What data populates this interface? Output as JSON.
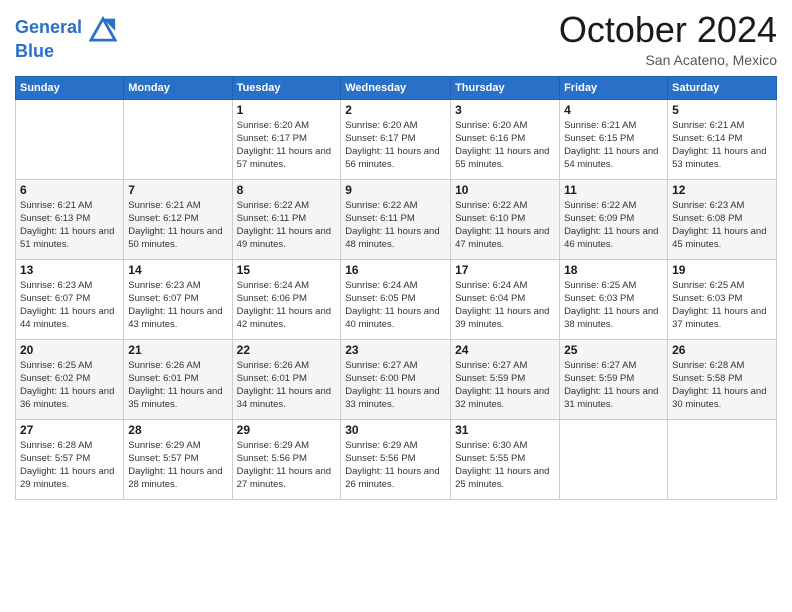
{
  "header": {
    "logo_line1": "General",
    "logo_line2": "Blue",
    "month": "October 2024",
    "location": "San Acateno, Mexico"
  },
  "weekdays": [
    "Sunday",
    "Monday",
    "Tuesday",
    "Wednesday",
    "Thursday",
    "Friday",
    "Saturday"
  ],
  "weeks": [
    [
      {
        "day": "",
        "info": ""
      },
      {
        "day": "",
        "info": ""
      },
      {
        "day": "1",
        "info": "Sunrise: 6:20 AM\nSunset: 6:17 PM\nDaylight: 11 hours and 57 minutes."
      },
      {
        "day": "2",
        "info": "Sunrise: 6:20 AM\nSunset: 6:17 PM\nDaylight: 11 hours and 56 minutes."
      },
      {
        "day": "3",
        "info": "Sunrise: 6:20 AM\nSunset: 6:16 PM\nDaylight: 11 hours and 55 minutes."
      },
      {
        "day": "4",
        "info": "Sunrise: 6:21 AM\nSunset: 6:15 PM\nDaylight: 11 hours and 54 minutes."
      },
      {
        "day": "5",
        "info": "Sunrise: 6:21 AM\nSunset: 6:14 PM\nDaylight: 11 hours and 53 minutes."
      }
    ],
    [
      {
        "day": "6",
        "info": "Sunrise: 6:21 AM\nSunset: 6:13 PM\nDaylight: 11 hours and 51 minutes."
      },
      {
        "day": "7",
        "info": "Sunrise: 6:21 AM\nSunset: 6:12 PM\nDaylight: 11 hours and 50 minutes."
      },
      {
        "day": "8",
        "info": "Sunrise: 6:22 AM\nSunset: 6:11 PM\nDaylight: 11 hours and 49 minutes."
      },
      {
        "day": "9",
        "info": "Sunrise: 6:22 AM\nSunset: 6:11 PM\nDaylight: 11 hours and 48 minutes."
      },
      {
        "day": "10",
        "info": "Sunrise: 6:22 AM\nSunset: 6:10 PM\nDaylight: 11 hours and 47 minutes."
      },
      {
        "day": "11",
        "info": "Sunrise: 6:22 AM\nSunset: 6:09 PM\nDaylight: 11 hours and 46 minutes."
      },
      {
        "day": "12",
        "info": "Sunrise: 6:23 AM\nSunset: 6:08 PM\nDaylight: 11 hours and 45 minutes."
      }
    ],
    [
      {
        "day": "13",
        "info": "Sunrise: 6:23 AM\nSunset: 6:07 PM\nDaylight: 11 hours and 44 minutes."
      },
      {
        "day": "14",
        "info": "Sunrise: 6:23 AM\nSunset: 6:07 PM\nDaylight: 11 hours and 43 minutes."
      },
      {
        "day": "15",
        "info": "Sunrise: 6:24 AM\nSunset: 6:06 PM\nDaylight: 11 hours and 42 minutes."
      },
      {
        "day": "16",
        "info": "Sunrise: 6:24 AM\nSunset: 6:05 PM\nDaylight: 11 hours and 40 minutes."
      },
      {
        "day": "17",
        "info": "Sunrise: 6:24 AM\nSunset: 6:04 PM\nDaylight: 11 hours and 39 minutes."
      },
      {
        "day": "18",
        "info": "Sunrise: 6:25 AM\nSunset: 6:03 PM\nDaylight: 11 hours and 38 minutes."
      },
      {
        "day": "19",
        "info": "Sunrise: 6:25 AM\nSunset: 6:03 PM\nDaylight: 11 hours and 37 minutes."
      }
    ],
    [
      {
        "day": "20",
        "info": "Sunrise: 6:25 AM\nSunset: 6:02 PM\nDaylight: 11 hours and 36 minutes."
      },
      {
        "day": "21",
        "info": "Sunrise: 6:26 AM\nSunset: 6:01 PM\nDaylight: 11 hours and 35 minutes."
      },
      {
        "day": "22",
        "info": "Sunrise: 6:26 AM\nSunset: 6:01 PM\nDaylight: 11 hours and 34 minutes."
      },
      {
        "day": "23",
        "info": "Sunrise: 6:27 AM\nSunset: 6:00 PM\nDaylight: 11 hours and 33 minutes."
      },
      {
        "day": "24",
        "info": "Sunrise: 6:27 AM\nSunset: 5:59 PM\nDaylight: 11 hours and 32 minutes."
      },
      {
        "day": "25",
        "info": "Sunrise: 6:27 AM\nSunset: 5:59 PM\nDaylight: 11 hours and 31 minutes."
      },
      {
        "day": "26",
        "info": "Sunrise: 6:28 AM\nSunset: 5:58 PM\nDaylight: 11 hours and 30 minutes."
      }
    ],
    [
      {
        "day": "27",
        "info": "Sunrise: 6:28 AM\nSunset: 5:57 PM\nDaylight: 11 hours and 29 minutes."
      },
      {
        "day": "28",
        "info": "Sunrise: 6:29 AM\nSunset: 5:57 PM\nDaylight: 11 hours and 28 minutes."
      },
      {
        "day": "29",
        "info": "Sunrise: 6:29 AM\nSunset: 5:56 PM\nDaylight: 11 hours and 27 minutes."
      },
      {
        "day": "30",
        "info": "Sunrise: 6:29 AM\nSunset: 5:56 PM\nDaylight: 11 hours and 26 minutes."
      },
      {
        "day": "31",
        "info": "Sunrise: 6:30 AM\nSunset: 5:55 PM\nDaylight: 11 hours and 25 minutes."
      },
      {
        "day": "",
        "info": ""
      },
      {
        "day": "",
        "info": ""
      }
    ]
  ]
}
